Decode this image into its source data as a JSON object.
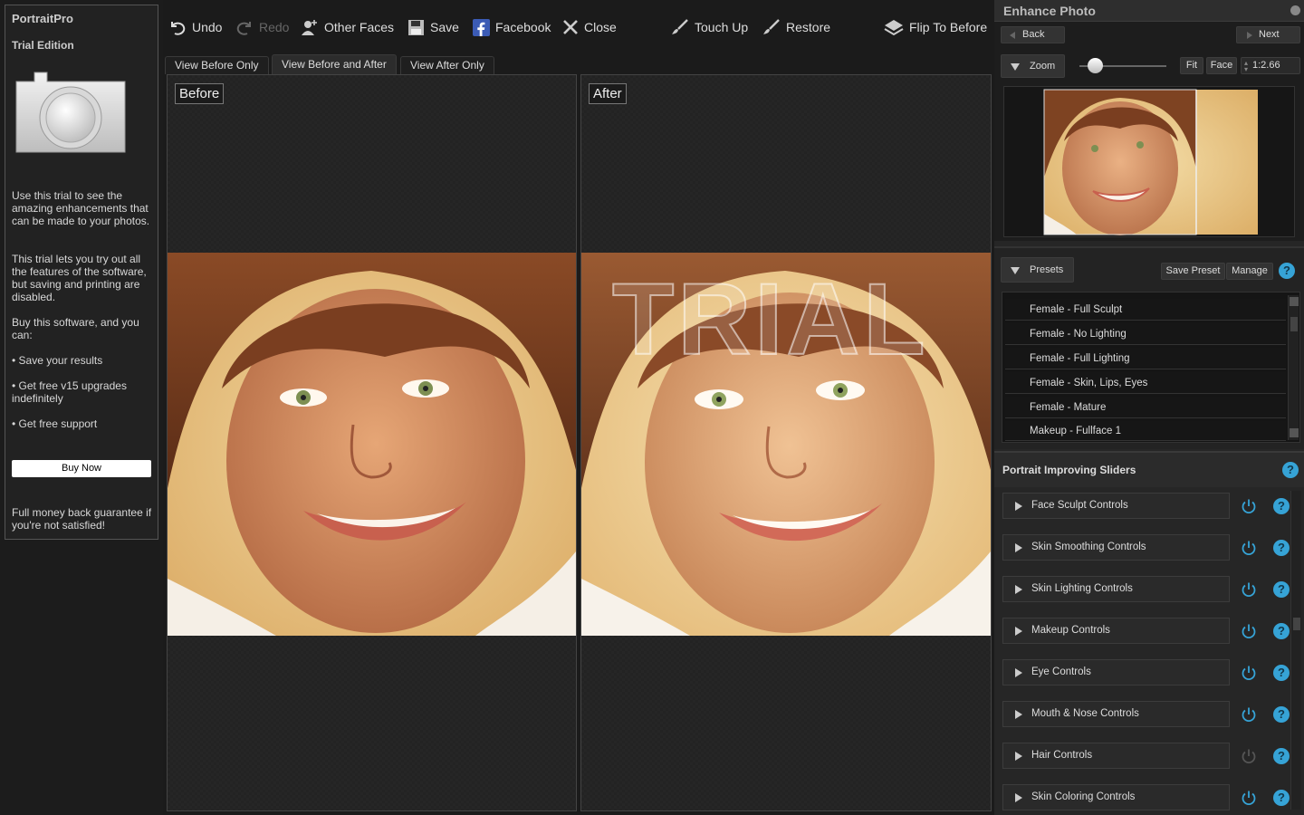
{
  "sidebar": {
    "app_name": "PortraitPro",
    "edition": "Trial Edition",
    "p1": "Use this trial to see the amazing enhancements that can be made to your photos.",
    "p2": "This trial lets you try out all the features of the software, but saving and printing are disabled.",
    "p3": "Buy this software, and you can:",
    "bullets": [
      "• Save your results",
      "• Get free v15 upgrades indefinitely",
      "• Get free support"
    ],
    "buy_label": "Buy Now",
    "guarantee": "Full money back guarantee if you're not satisfied!"
  },
  "toolbar": {
    "undo": "Undo",
    "redo": "Redo",
    "other_faces": "Other Faces",
    "save": "Save",
    "facebook": "Facebook",
    "close": "Close",
    "touch_up": "Touch Up",
    "restore": "Restore",
    "flip": "Flip To Before"
  },
  "view_tabs": [
    "View Before Only",
    "View Before and After",
    "View After Only"
  ],
  "active_tab": "View Before and After",
  "panes": {
    "before": "Before",
    "after": "After",
    "watermark": "TRIAL"
  },
  "right": {
    "title": "Enhance Photo",
    "back": "Back",
    "next": "Next",
    "zoom_label": "Zoom",
    "fit": "Fit",
    "face": "Face",
    "zoom_value": "1:2.66",
    "presets_label": "Presets",
    "save_preset": "Save Preset",
    "manage": "Manage",
    "presets": [
      "Female - Full Sculpt",
      "Female - No Lighting",
      "Female - Full Lighting",
      "Female - Skin, Lips, Eyes",
      "Female - Mature",
      "Makeup - Fullface 1"
    ],
    "sliders_title": "Portrait Improving Sliders",
    "sliders": [
      "Face Sculpt Controls",
      "Skin Smoothing Controls",
      "Skin Lighting Controls",
      "Makeup Controls",
      "Eye Controls",
      "Mouth & Nose Controls",
      "Hair Controls",
      "Skin Coloring Controls"
    ],
    "help_glyph": "?"
  },
  "colors": {
    "accent": "#36a3d6",
    "bg": "#1b1b1b"
  }
}
